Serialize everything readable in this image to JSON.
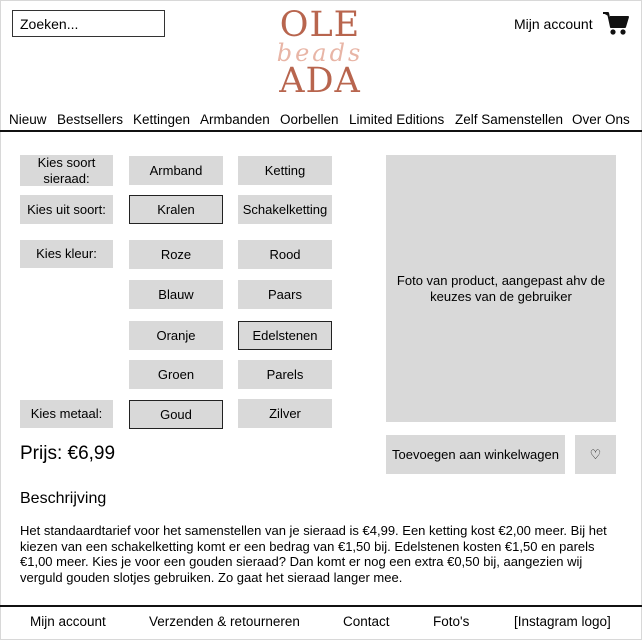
{
  "header": {
    "search_placeholder": "Zoeken...",
    "logo": {
      "line1": "OLE",
      "line2": "beads",
      "line3": "ADA"
    },
    "account_label": "Mijn account",
    "cart_icon": "cart-icon"
  },
  "nav": {
    "items": [
      "Nieuw",
      "Bestsellers",
      "Kettingen",
      "Armbanden",
      "Oorbellen",
      "Limited Editions",
      "Zelf Samenstellen",
      "Over Ons"
    ]
  },
  "config": {
    "type_label": "Kies soort sieraad:",
    "type_options": [
      "Armband",
      "Ketting"
    ],
    "kind_label": "Kies uit soort:",
    "kind_options": [
      "Kralen",
      "Schakelketting"
    ],
    "kind_selected": "Kralen",
    "color_label": "Kies kleur:",
    "color_options": [
      "Roze",
      "Rood",
      "Blauw",
      "Paars",
      "Oranje",
      "Edelstenen",
      "Groen",
      "Parels"
    ],
    "color_selected": "Edelstenen",
    "metal_label": "Kies metaal:",
    "metal_options": [
      "Goud",
      "Zilver"
    ],
    "metal_selected": "Goud"
  },
  "product": {
    "photo_text": "Foto van product, aangepast ahv de keuzes van de gebruiker",
    "add_to_cart": "Toevoegen aan winkelwagen",
    "favorite": "♡",
    "price": "Prijs: €6,99"
  },
  "description": {
    "title": "Beschrijving",
    "text": "Het standaardtarief voor het samenstellen van je sieraad is €4,99. Een ketting kost €2,00 meer. Bij het kiezen van een schakelketting komt er een bedrag van €1,50 bij. Edelstenen kosten €1,50 en parels €1,00 meer. Kies je voor een gouden sieraad? Dan komt er nog een extra €0,50 bij, aangezien wij verguld gouden slotjes gebruiken. Zo gaat het sieraad langer mee."
  },
  "footer": {
    "items": [
      "Mijn account",
      "Verzenden & retourneren",
      "Contact",
      "Foto's",
      "[Instagram logo]"
    ]
  },
  "colors": {
    "logo": "#b8654e",
    "logo_script": "#e8b5a6",
    "option_bg": "#d9d9d9"
  }
}
